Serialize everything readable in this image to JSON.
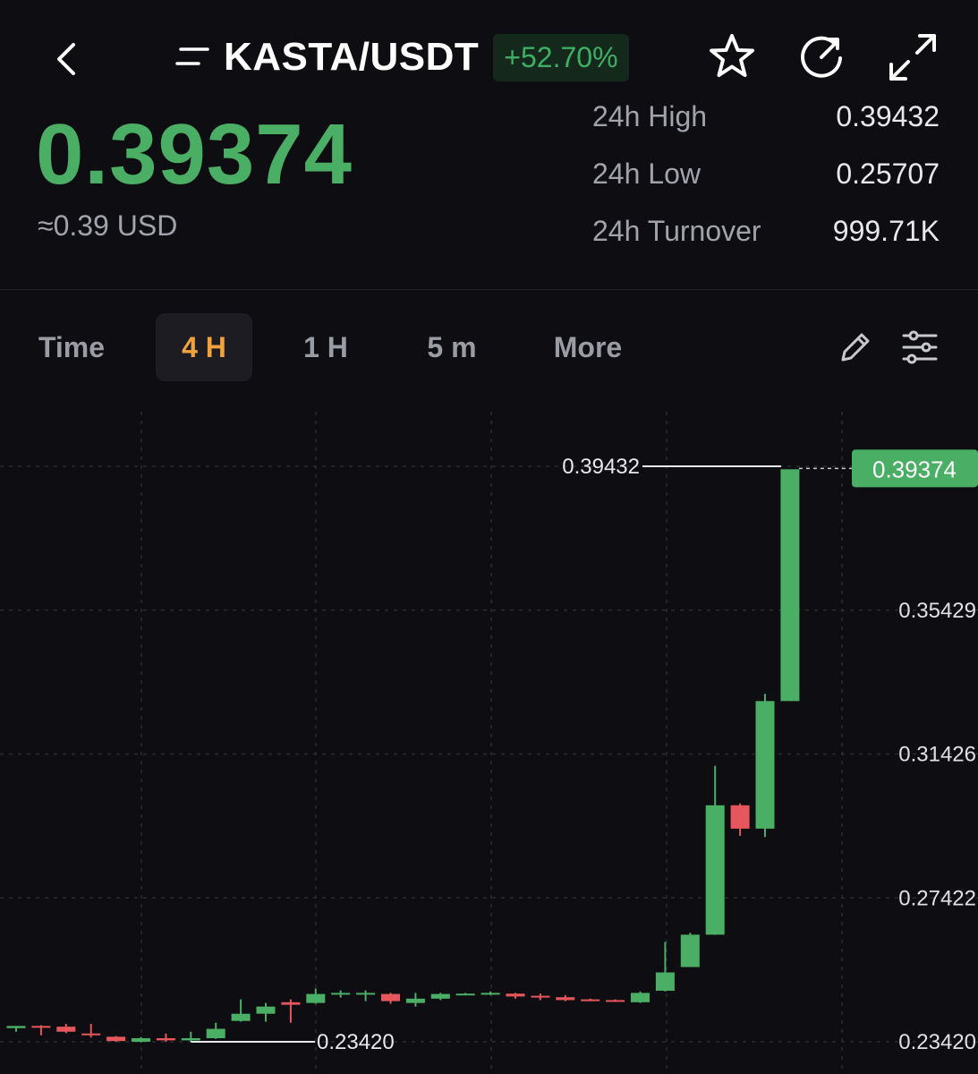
{
  "header": {
    "pair": "KASTA/USDT",
    "change_pct": "+52.70%"
  },
  "ticker": {
    "last_price": "0.39374",
    "usd_approx": "≈0.39 USD",
    "stats": [
      {
        "label": "24h High",
        "value": "0.39432"
      },
      {
        "label": "24h Low",
        "value": "0.25707"
      },
      {
        "label": "24h Turnover",
        "value": "999.71K"
      }
    ]
  },
  "tabs": [
    {
      "label": "Time"
    },
    {
      "label": "4 H",
      "active": true
    },
    {
      "label": "1 H"
    },
    {
      "label": "5 m"
    },
    {
      "label": "More"
    }
  ],
  "colors": {
    "up": "#4aae64",
    "down": "#e5575c",
    "accent": "#f0a33c",
    "background": "#0e0e12"
  },
  "icons": {
    "back": "chevron-left-icon",
    "menu": "menu-lines-icon",
    "favorite": "star-icon",
    "share": "refresh-arrow-icon",
    "fullscreen": "expand-icon",
    "draw": "pencil-icon",
    "settings": "sliders-icon"
  },
  "chart_data": {
    "type": "candlestick",
    "y_ticks": [
      "0.35429",
      "0.31426",
      "0.27422",
      "0.23420"
    ],
    "ylim": [
      0.2342,
      0.39432
    ],
    "high_label": "0.39432",
    "low_label": "0.23420",
    "last_price_label": "0.39374",
    "last_price": 0.39374,
    "grid": true,
    "candles": [
      {
        "o": 0.238,
        "h": 0.2385,
        "l": 0.237,
        "c": 0.2386
      },
      {
        "o": 0.2386,
        "h": 0.2388,
        "l": 0.236,
        "c": 0.2384
      },
      {
        "o": 0.2384,
        "h": 0.2392,
        "l": 0.2366,
        "c": 0.237
      },
      {
        "o": 0.2365,
        "h": 0.2392,
        "l": 0.2354,
        "c": 0.236
      },
      {
        "o": 0.2356,
        "h": 0.2358,
        "l": 0.2342,
        "c": 0.2344
      },
      {
        "o": 0.2342,
        "h": 0.2355,
        "l": 0.234,
        "c": 0.2352
      },
      {
        "o": 0.2352,
        "h": 0.2365,
        "l": 0.2342,
        "c": 0.2346
      },
      {
        "o": 0.2346,
        "h": 0.237,
        "l": 0.2342,
        "c": 0.2352
      },
      {
        "o": 0.2352,
        "h": 0.2395,
        "l": 0.235,
        "c": 0.2378
      },
      {
        "o": 0.24,
        "h": 0.246,
        "l": 0.2398,
        "c": 0.242
      },
      {
        "o": 0.242,
        "h": 0.245,
        "l": 0.2398,
        "c": 0.244
      },
      {
        "o": 0.2452,
        "h": 0.246,
        "l": 0.2395,
        "c": 0.2445
      },
      {
        "o": 0.245,
        "h": 0.249,
        "l": 0.2448,
        "c": 0.2475
      },
      {
        "o": 0.2475,
        "h": 0.2485,
        "l": 0.2465,
        "c": 0.2478
      },
      {
        "o": 0.2475,
        "h": 0.2485,
        "l": 0.2455,
        "c": 0.2478
      },
      {
        "o": 0.2475,
        "h": 0.2478,
        "l": 0.2448,
        "c": 0.2455
      },
      {
        "o": 0.245,
        "h": 0.2478,
        "l": 0.244,
        "c": 0.2462
      },
      {
        "o": 0.2462,
        "h": 0.2478,
        "l": 0.2458,
        "c": 0.2475
      },
      {
        "o": 0.2475,
        "h": 0.2478,
        "l": 0.2472,
        "c": 0.2476
      },
      {
        "o": 0.2476,
        "h": 0.2482,
        "l": 0.2472,
        "c": 0.2478
      },
      {
        "o": 0.2476,
        "h": 0.2478,
        "l": 0.2462,
        "c": 0.2468
      },
      {
        "o": 0.247,
        "h": 0.2476,
        "l": 0.2458,
        "c": 0.2465
      },
      {
        "o": 0.2466,
        "h": 0.2472,
        "l": 0.2455,
        "c": 0.2458
      },
      {
        "o": 0.246,
        "h": 0.2462,
        "l": 0.2455,
        "c": 0.2458
      },
      {
        "o": 0.2458,
        "h": 0.246,
        "l": 0.2453,
        "c": 0.2455
      },
      {
        "o": 0.2452,
        "h": 0.2482,
        "l": 0.245,
        "c": 0.2478
      },
      {
        "o": 0.2484,
        "h": 0.262,
        "l": 0.2482,
        "c": 0.2535
      },
      {
        "o": 0.255,
        "h": 0.2645,
        "l": 0.255,
        "c": 0.264
      },
      {
        "o": 0.264,
        "h": 0.311,
        "l": 0.264,
        "c": 0.3
      },
      {
        "o": 0.3,
        "h": 0.3005,
        "l": 0.2915,
        "c": 0.2935
      },
      {
        "o": 0.2935,
        "h": 0.331,
        "l": 0.2912,
        "c": 0.329
      },
      {
        "o": 0.329,
        "h": 0.38,
        "l": 0.329,
        "c": 0.3935
      }
    ]
  }
}
